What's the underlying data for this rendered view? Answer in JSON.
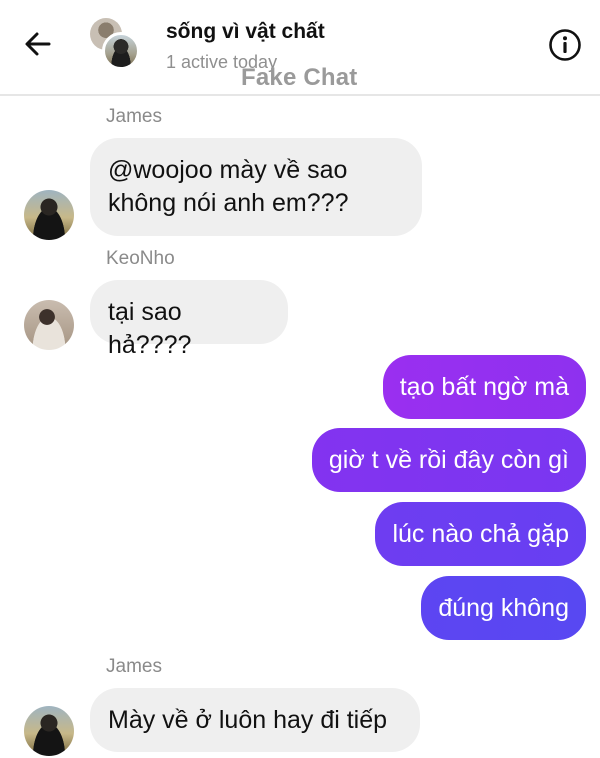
{
  "header": {
    "title": "sống vì vật chất",
    "status": "1 active today",
    "watermark": "Fake Chat",
    "back_icon": "back-arrow-icon",
    "info_icon": "info-icon"
  },
  "messages": [
    {
      "sender": "James",
      "direction": "incoming",
      "lines": [
        "@woojoo mày về sao",
        "không nói anh em???"
      ]
    },
    {
      "sender": "KeoNho",
      "direction": "incoming",
      "lines": [
        "tại sao hả????"
      ]
    },
    {
      "direction": "outgoing",
      "lines": [
        "tạo bất ngờ mà"
      ]
    },
    {
      "direction": "outgoing",
      "lines": [
        "giờ t về rồi đây còn gì"
      ]
    },
    {
      "direction": "outgoing",
      "lines": [
        "lúc nào chả gặp"
      ]
    },
    {
      "direction": "outgoing",
      "lines": [
        "đúng không"
      ]
    },
    {
      "sender": "James",
      "direction": "incoming",
      "lines": [
        "Mày về ở luôn hay đi tiếp"
      ]
    }
  ],
  "colors": {
    "incoming_bubble": "#efefef",
    "outgoing_gradient": [
      "#a12ef0",
      "#5a46f2"
    ],
    "secondary_text": "#8a8a8a"
  }
}
